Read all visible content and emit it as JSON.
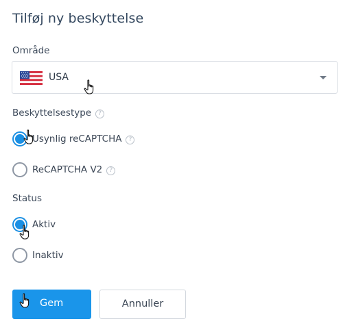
{
  "dialog": {
    "title": "Tilføj ny beskyttelse"
  },
  "region": {
    "label": "Område",
    "selected": "USA",
    "flag_icon": "us-flag-icon"
  },
  "protection_type": {
    "label": "Beskyttelsestype",
    "options": [
      {
        "label": "Usynlig reCAPTCHA",
        "checked": true
      },
      {
        "label": "ReCAPTCHA V2",
        "checked": false
      }
    ]
  },
  "status": {
    "label": "Status",
    "options": [
      {
        "label": "Aktiv",
        "checked": true
      },
      {
        "label": "Inaktiv",
        "checked": false
      }
    ]
  },
  "buttons": {
    "save": "Gem",
    "cancel": "Annuller"
  },
  "colors": {
    "accent": "#1a95ea",
    "radio_checked": "#1a8fe3",
    "border": "#d9dde3",
    "title": "#34485f"
  }
}
